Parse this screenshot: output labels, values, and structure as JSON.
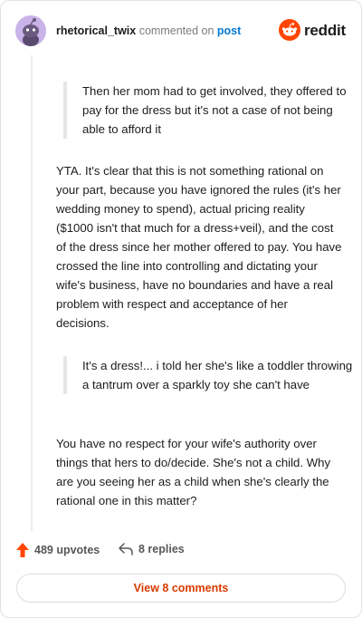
{
  "header": {
    "username": "rhetorical_twix",
    "commented_on": "commented on",
    "post_link": "post",
    "brand": "reddit"
  },
  "content": {
    "quote1": "Then her mom had to get involved, they offered to pay for the dress but it's not a case of not being able to afford it",
    "para1": "YTA. It's clear that this is not something rational on your part, because you have ignored the rules (it's her wedding money to spend), actual pricing reality ($1000 isn't that much for a dress+veil), and the cost of the dress since her mother offered to pay. You have crossed the line into controlling and dictating your wife's business, have no boundaries and have a real problem with respect and acceptance of her decisions.",
    "quote2": "It's a dress!... i told her she's like a toddler throwing a tantrum over a sparkly toy she can't have",
    "para2": "You have no respect for your wife's authority over things that hers to do/decide. She's not a child. Why are you seeing her as a child when she's clearly the rational one in this matter?"
  },
  "footer": {
    "upvotes": "489 upvotes",
    "replies": "8 replies",
    "view_comments": "View 8 comments"
  },
  "colors": {
    "accent": "#ff4500",
    "link": "#0079d3",
    "view_comments": "#d93a00",
    "avatar_bg": "#c9b3e8"
  },
  "icons": {
    "upvote": "upvote-arrow-icon",
    "reply": "reply-arrow-icon",
    "brand": "reddit-snoo-icon"
  }
}
